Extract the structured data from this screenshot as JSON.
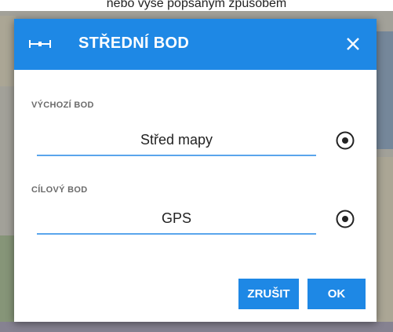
{
  "window": {
    "top_caption": "nebo výše popsaným způsobem"
  },
  "dialog": {
    "title": "STŘEDNÍ BOD",
    "icon": "midpoint-icon",
    "close_icon": "close-icon",
    "start": {
      "label": "VÝCHOZÍ BOD",
      "value": "Střed mapy",
      "button_icon": "target-icon"
    },
    "destination": {
      "label": "CÍLOVÝ BOD",
      "value": "GPS",
      "button_icon": "target-icon"
    },
    "buttons": {
      "cancel": "ZRUŠIT",
      "ok": "OK"
    }
  },
  "colors": {
    "accent": "#1e88e5",
    "underline": "#5aa5ec"
  }
}
